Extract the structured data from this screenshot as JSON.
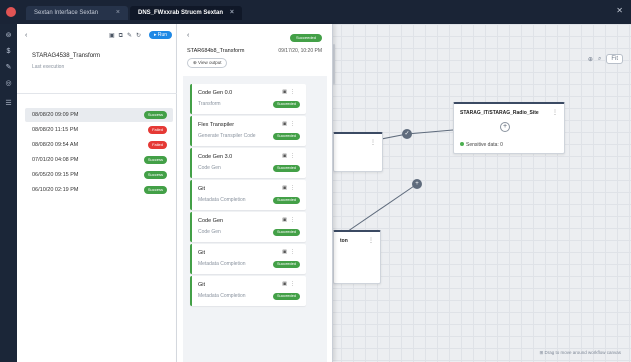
{
  "tabs": [
    {
      "label": "Sextan Interface Sextan"
    },
    {
      "label": "DNS_FWxxrab Strucm Sextan"
    }
  ],
  "canvas": {
    "tools": {
      "zoom": "⊕",
      "search": "⌕",
      "label": "Fit"
    },
    "footer": "⊞ Drag to move around workflow canvas",
    "nodes": [
      {
        "title": "STARAG_IT/STARAG_Radio_Site",
        "footer": "Sensitive data: 0"
      },
      {
        "title": "",
        "footer": ""
      },
      {
        "title": "ton",
        "footer": ""
      },
      {
        "title": "",
        "footer": ""
      }
    ]
  },
  "list_panel": {
    "run_label": "▸ Run",
    "title": "STARAG4538_Transform",
    "subtitle": "Last execution",
    "rows": [
      {
        "date": "08/08/20 09:09 PM",
        "status": "Success",
        "kind": "ok"
      },
      {
        "date": "08/08/20 11:15 PM",
        "status": "Failed",
        "kind": "fail"
      },
      {
        "date": "08/08/20 09:54 AM",
        "status": "Failed",
        "kind": "fail"
      },
      {
        "date": "07/01/20 04:08 PM",
        "status": "Success",
        "kind": "ok"
      },
      {
        "date": "06/05/20 09:15 PM",
        "status": "Success",
        "kind": "ok"
      },
      {
        "date": "06/10/20 02:19 PM",
        "status": "Success",
        "kind": "ok"
      }
    ]
  },
  "detail_panel": {
    "status": "Succeeded",
    "title": "STAR684b8_Transform",
    "date": "09/17/20, 10:20 PM",
    "chip": "⊕ View output",
    "steps": [
      {
        "name": "Code Gen 0.0",
        "desc": "Transform",
        "status": "Succeeded"
      },
      {
        "name": "Flex Transpiler",
        "desc": "Generate Transpiler Code",
        "status": "Succeeded"
      },
      {
        "name": "Code Gen 3.0",
        "desc": "Code Gen",
        "status": "Succeeded"
      },
      {
        "name": "Git",
        "desc": "Metadata Completion",
        "status": "Succeeded"
      },
      {
        "name": "Code Gen",
        "desc": "Code Gen",
        "status": "Succeeded"
      },
      {
        "name": "Git",
        "desc": "Metadata Completion",
        "status": "Succeeded"
      },
      {
        "name": "Git",
        "desc": "Metadata Completion",
        "status": "Succeeded"
      }
    ]
  },
  "colors": {
    "success": "#43a047",
    "failed": "#e53935",
    "run": "#1e88e5",
    "tabbar": "#1a2436"
  }
}
